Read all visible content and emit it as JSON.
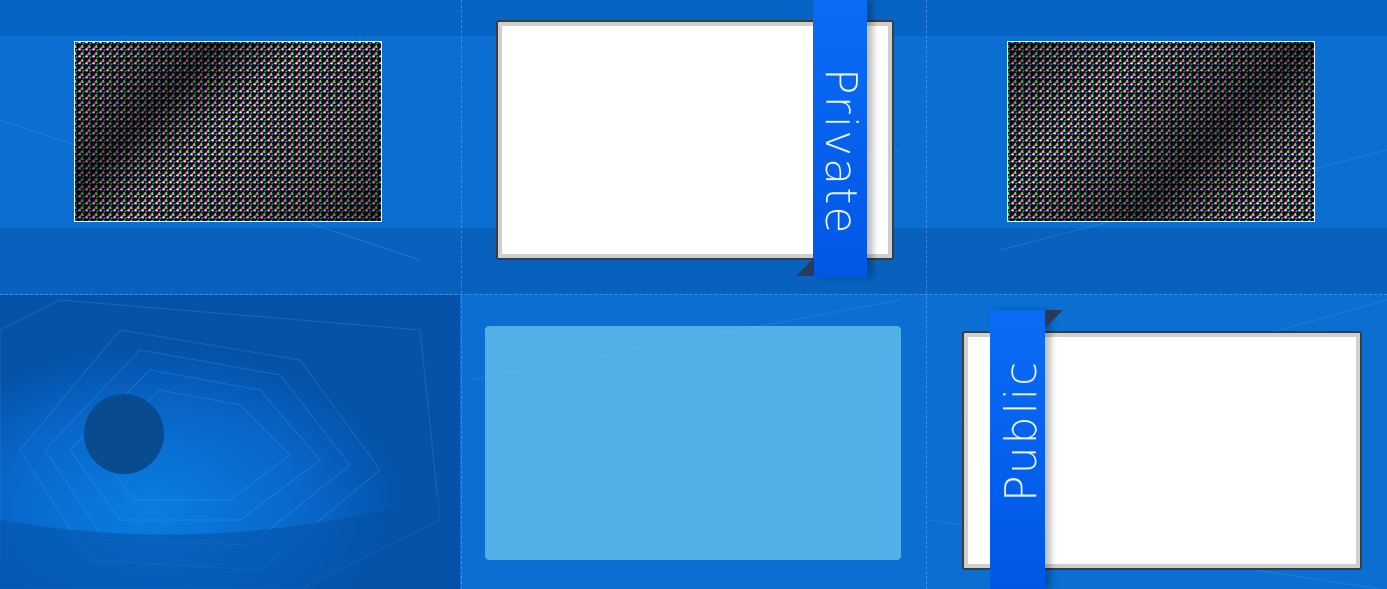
{
  "labels": {
    "private": "Private",
    "public": "Public"
  },
  "colors": {
    "background": "#0a6fd0",
    "ribbon": "#0a6cf5",
    "card": "#ffffff",
    "glass_panel": "#7fd2f0",
    "circle": "#084c8f"
  },
  "icons": {
    "thumbnail_top_left": "halftone-pattern-image",
    "thumbnail_top_right": "halftone-pattern-image",
    "indicator": "circle-icon"
  }
}
